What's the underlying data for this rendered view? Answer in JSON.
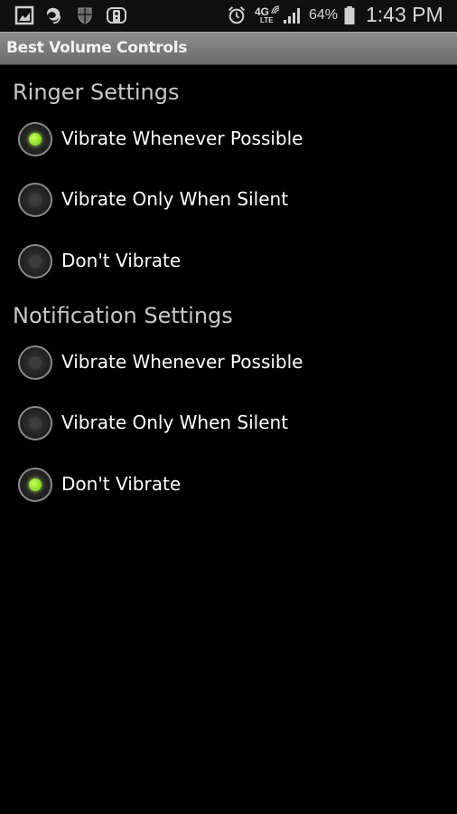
{
  "status_bar": {
    "left_icons": [
      "gallery-icon",
      "sync-icon",
      "shield-icon",
      "remote-icon"
    ],
    "right_icons": [
      "alarm-icon",
      "4g-lte-icon",
      "signal-icon",
      "battery-icon"
    ],
    "network_label": "4G",
    "network_sub": "LTE",
    "battery_percent": "64%",
    "battery_level": 0.64,
    "time": "1:43 PM"
  },
  "app": {
    "title": "Best Volume Controls"
  },
  "colors": {
    "accent": "#8fe028",
    "title_bar": "#7c7c7c",
    "background": "#000000"
  },
  "sections": [
    {
      "header": "Ringer Settings",
      "options": [
        {
          "label": "Vibrate Whenever Possible",
          "checked": true
        },
        {
          "label": "Vibrate Only When Silent",
          "checked": false
        },
        {
          "label": "Don't Vibrate",
          "checked": false
        }
      ]
    },
    {
      "header": "Notification Settings",
      "options": [
        {
          "label": "Vibrate Whenever Possible",
          "checked": false
        },
        {
          "label": "Vibrate Only When Silent",
          "checked": false
        },
        {
          "label": "Don't Vibrate",
          "checked": true
        }
      ]
    }
  ]
}
